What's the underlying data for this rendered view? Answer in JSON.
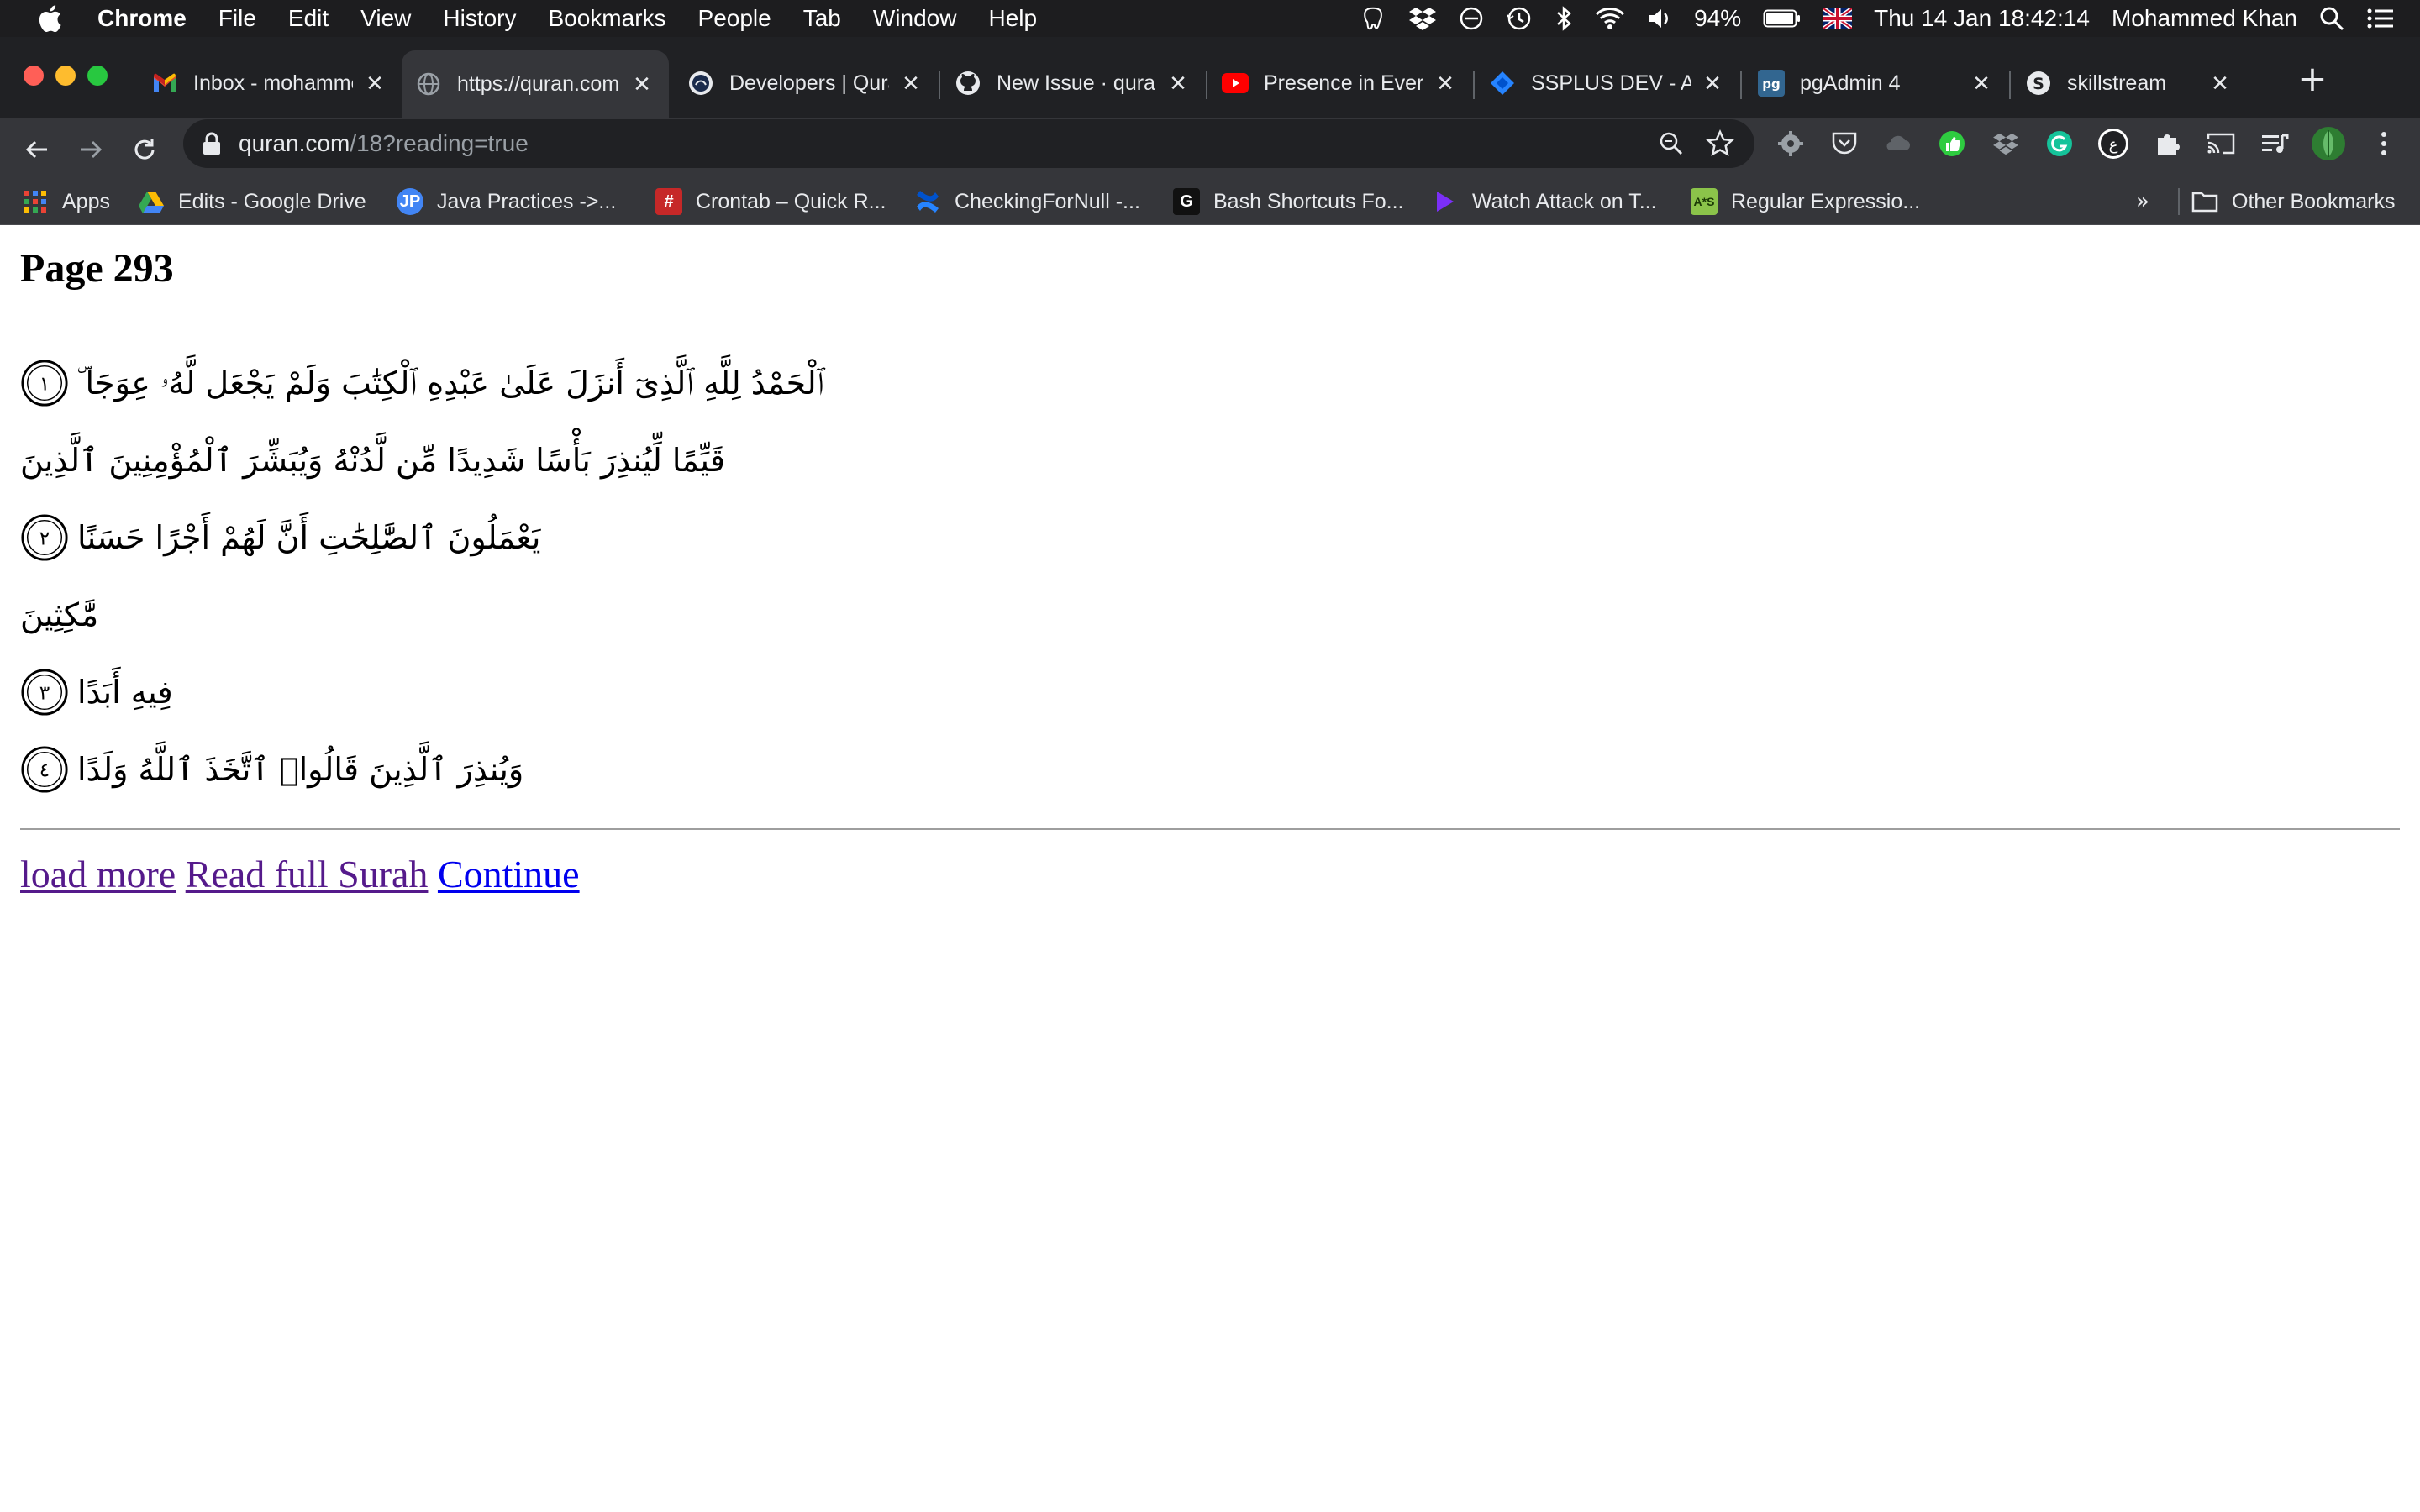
{
  "os_menubar": {
    "app_name": "Chrome",
    "menus": [
      "File",
      "Edit",
      "View",
      "History",
      "Bookmarks",
      "People",
      "Tab",
      "Window",
      "Help"
    ],
    "battery": "94%",
    "datetime": "Thu 14 Jan  18:42:14",
    "user": "Mohammed Khan"
  },
  "tabs": [
    {
      "title": "Inbox - mohammed",
      "icon": "gmail-icon",
      "active": false
    },
    {
      "title": "https://quran.com",
      "icon": "globe-icon",
      "active": true
    },
    {
      "title": "Developers | Quran",
      "icon": "quran-dev-icon",
      "active": false
    },
    {
      "title": "New Issue · quran",
      "icon": "github-icon",
      "active": false
    },
    {
      "title": "Presence in Every",
      "icon": "youtube-icon",
      "active": false
    },
    {
      "title": "SSPLUS DEV - Agile",
      "icon": "jira-icon",
      "active": false
    },
    {
      "title": "pgAdmin 4",
      "icon": "pgadmin-icon",
      "active": false
    },
    {
      "title": "skillstream",
      "icon": "skillstream-icon",
      "active": false
    }
  ],
  "address_bar": {
    "host": "quran.com",
    "path": "/18?reading=true"
  },
  "bookmarks": [
    {
      "label": "Apps",
      "icon": "apps-grid-icon",
      "color": "#ea4335"
    },
    {
      "label": "Edits - Google Drive",
      "icon": "google-drive-icon",
      "color": "#fbbc04"
    },
    {
      "label": "Java Practices ->...",
      "icon": "jp-icon",
      "color": "#4285f4"
    },
    {
      "label": "Crontab – Quick R...",
      "icon": "hash-icon",
      "color": "#c62828"
    },
    {
      "label": "CheckingForNull -...",
      "icon": "confluence-icon",
      "color": "#2684ff"
    },
    {
      "label": "Bash Shortcuts Fo...",
      "icon": "g-icon",
      "color": "#111111"
    },
    {
      "label": "Watch Attack on T...",
      "icon": "play-icon",
      "color": "#7b2ff7"
    },
    {
      "label": "Regular Expressio...",
      "icon": "regex-icon",
      "color": "#8bc34a"
    }
  ],
  "bookmarks_more": "»",
  "other_bookmarks": "Other Bookmarks",
  "page": {
    "title": "Page 293",
    "verse_lines": [
      {
        "text": "ٱلْحَمْدُ لِلَّهِ ٱلَّذِىٓ أَنزَلَ عَلَىٰ عَبْدِهِ ٱلْكِتَٰبَ وَلَمْ يَجْعَل لَّهُۥ عِوَجَا ۜ",
        "ayah": "١"
      },
      {
        "text": "قَيِّمًا لِّيُنذِرَ بَأْسًا شَدِيدًا مِّن لَّدُنْهُ وَيُبَشِّرَ ٱلْمُؤْمِنِينَ ٱلَّذِينَ",
        "ayah": ""
      },
      {
        "text": "يَعْمَلُونَ ٱلصَّٰلِحَٰتِ أَنَّ لَهُمْ أَجْرًا حَسَنًا",
        "ayah": "٢"
      },
      {
        "text": "مَّٰكِثِينَ",
        "ayah": ""
      },
      {
        "text": "فِيهِ أَبَدًا",
        "ayah": "٣"
      },
      {
        "text": "وَيُنذِرَ ٱلَّذِينَ قَالُوا۟ ٱتَّخَذَ ٱللَّهُ وَلَدًا",
        "ayah": "٤"
      }
    ],
    "links": [
      "load more",
      "Read full Surah",
      "Continue"
    ]
  }
}
